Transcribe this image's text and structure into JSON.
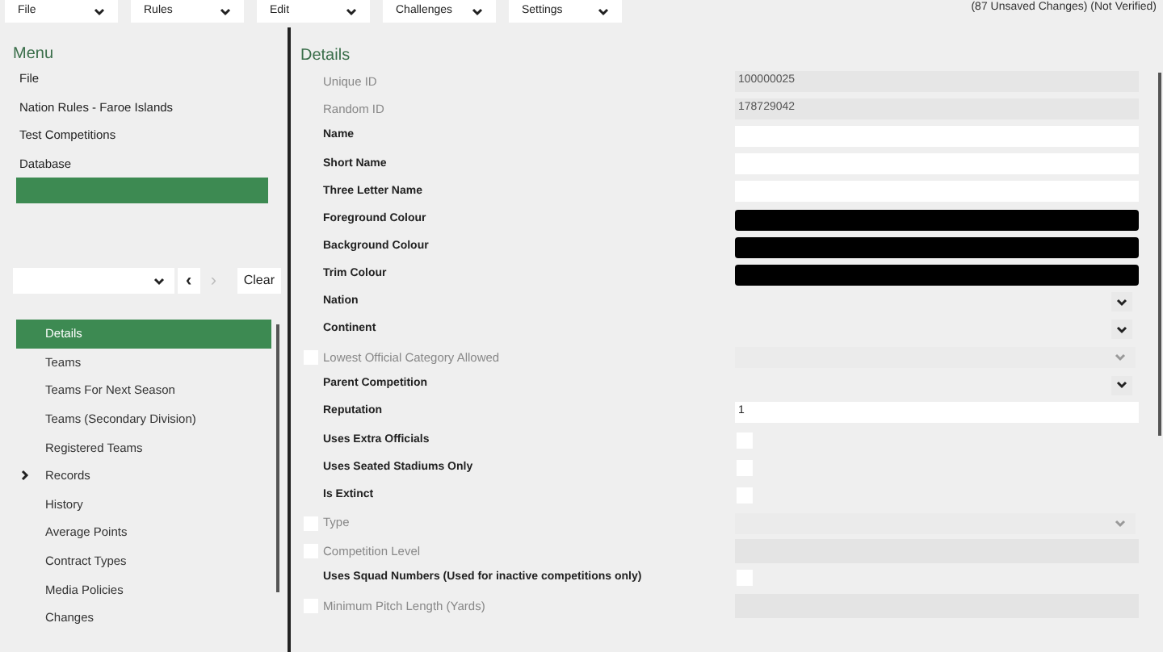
{
  "menu_bar": [
    {
      "label": "File"
    },
    {
      "label": "Rules"
    },
    {
      "label": "Edit"
    },
    {
      "label": "Challenges"
    },
    {
      "label": "Settings"
    }
  ],
  "status_text": "(87 Unsaved Changes) (Not Verified)",
  "sidebar": {
    "title": "Menu",
    "items": [
      {
        "label": "File"
      },
      {
        "label": "Nation Rules - Faroe Islands"
      },
      {
        "label": "Test Competitions"
      },
      {
        "label": "Database"
      }
    ],
    "nav_back": {
      "label": "‹",
      "disabled": false
    },
    "nav_forward": {
      "label": "›",
      "disabled": true
    },
    "clear_button": "Clear",
    "sections": [
      {
        "label": "Details",
        "selected": true,
        "expandable": false
      },
      {
        "label": "Teams",
        "selected": false,
        "expandable": false
      },
      {
        "label": "Teams For Next Season",
        "selected": false,
        "expandable": false
      },
      {
        "label": "Teams (Secondary Division)",
        "selected": false,
        "expandable": false
      },
      {
        "label": "Registered Teams",
        "selected": false,
        "expandable": false
      },
      {
        "label": "Records",
        "selected": false,
        "expandable": true
      },
      {
        "label": "History",
        "selected": false,
        "expandable": false
      },
      {
        "label": "Average Points",
        "selected": false,
        "expandable": false
      },
      {
        "label": "Contract Types",
        "selected": false,
        "expandable": false
      },
      {
        "label": "Media Policies",
        "selected": false,
        "expandable": false
      },
      {
        "label": "Changes",
        "selected": false,
        "expandable": false
      }
    ]
  },
  "details": {
    "title": "Details",
    "fields": [
      {
        "label": "Unique ID",
        "kind": "readonly",
        "value": "100000025",
        "disabled": true
      },
      {
        "label": "Random ID",
        "kind": "readonly",
        "value": "178729042",
        "disabled": true
      },
      {
        "label": "Name",
        "kind": "text",
        "disabled": false
      },
      {
        "label": "Short Name",
        "kind": "text",
        "disabled": false
      },
      {
        "label": "Three Letter Name",
        "kind": "text",
        "disabled": false
      },
      {
        "label": "Foreground Colour",
        "kind": "colour",
        "color": "#000000",
        "disabled": false
      },
      {
        "label": "Background Colour",
        "kind": "colour",
        "color": "#000000",
        "disabled": false
      },
      {
        "label": "Trim Colour",
        "kind": "colour",
        "color": "#000000",
        "disabled": false
      },
      {
        "label": "Nation",
        "kind": "select",
        "disabled": false
      },
      {
        "label": "Continent",
        "kind": "select",
        "disabled": false
      },
      {
        "label": "Lowest Official Category Allowed",
        "kind": "select",
        "disabled": true,
        "enabled": false
      },
      {
        "label": "Parent Competition",
        "kind": "select",
        "disabled": false
      },
      {
        "label": "Reputation",
        "kind": "text",
        "value": "1",
        "disabled": false
      },
      {
        "label": "Uses Extra Officials",
        "kind": "checkbox",
        "checked": false,
        "disabled": false
      },
      {
        "label": "Uses Seated Stadiums Only",
        "kind": "checkbox",
        "checked": false,
        "disabled": false
      },
      {
        "label": "Is Extinct",
        "kind": "checkbox",
        "checked": false,
        "disabled": false
      },
      {
        "label": "Type",
        "kind": "select",
        "disabled": true,
        "enabled": false
      },
      {
        "label": "Competition Level",
        "kind": "text",
        "disabled": true,
        "enabled": false
      },
      {
        "label": "Uses Squad Numbers (Used for inactive competitions only)",
        "kind": "checkbox",
        "checked": false,
        "disabled": false
      },
      {
        "label": "Minimum Pitch Length (Yards)",
        "kind": "text",
        "disabled": true,
        "enabled": false
      }
    ]
  }
}
